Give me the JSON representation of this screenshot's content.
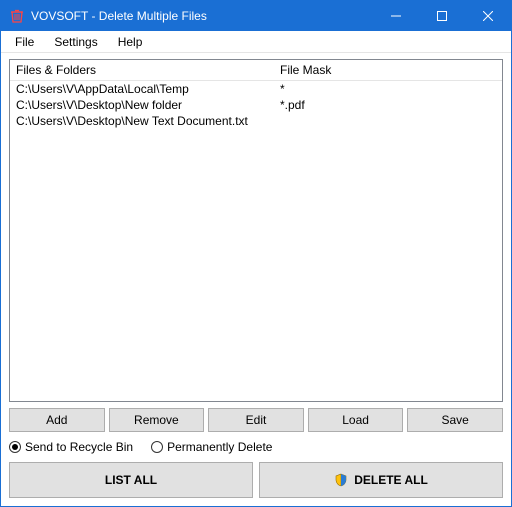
{
  "window": {
    "title": "VOVSOFT - Delete Multiple Files"
  },
  "menu": {
    "file": "File",
    "settings": "Settings",
    "help": "Help"
  },
  "columns": {
    "files": "Files & Folders",
    "mask": "File Mask"
  },
  "rows": [
    {
      "path": "C:\\Users\\V\\AppData\\Local\\Temp",
      "mask": "*"
    },
    {
      "path": "C:\\Users\\V\\Desktop\\New folder",
      "mask": "*.pdf"
    },
    {
      "path": "C:\\Users\\V\\Desktop\\New Text Document.txt",
      "mask": ""
    }
  ],
  "toolbar": {
    "add": "Add",
    "remove": "Remove",
    "edit": "Edit",
    "load": "Load",
    "save": "Save"
  },
  "options": {
    "recycle": "Send to Recycle Bin",
    "permanent": "Permanently Delete",
    "selected": "recycle"
  },
  "actions": {
    "list_all": "LIST ALL",
    "delete_all": "DELETE ALL"
  }
}
